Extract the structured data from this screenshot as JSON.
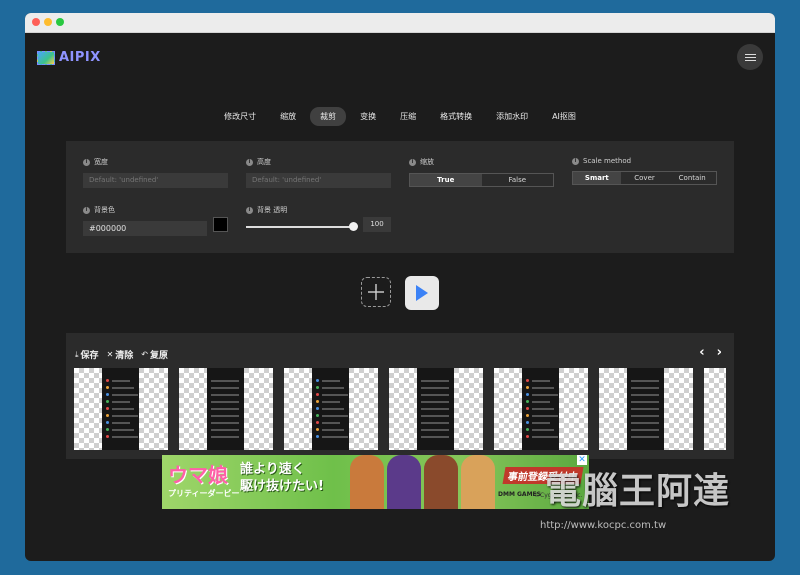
{
  "app": {
    "name": "AIPIX"
  },
  "tabs": [
    {
      "label": "修改尺寸",
      "active": false
    },
    {
      "label": "缩放",
      "active": false
    },
    {
      "label": "裁剪",
      "active": true
    },
    {
      "label": "变换",
      "active": false
    },
    {
      "label": "压缩",
      "active": false
    },
    {
      "label": "格式转换",
      "active": false
    },
    {
      "label": "添加水印",
      "active": false
    },
    {
      "label": "AI抠图",
      "active": false
    }
  ],
  "settings": {
    "width": {
      "label": "宽度",
      "placeholder": "Default: 'undefined'"
    },
    "height": {
      "label": "高度",
      "placeholder": "Default: 'undefined'"
    },
    "scale": {
      "label": "缩放",
      "options": [
        "True",
        "False"
      ],
      "selected": "True"
    },
    "scale_method": {
      "label": "Scale method",
      "options": [
        "Smart",
        "Cover",
        "Contain"
      ],
      "selected": "Smart"
    },
    "bg_color": {
      "label": "背景色",
      "value": "#000000",
      "swatch": "#000000"
    },
    "bg_opacity": {
      "label": "背景 透明",
      "value": "100",
      "fraction": 1.0
    }
  },
  "results": {
    "save_label": "保存",
    "clear_label": "清除",
    "restore_label": "复原",
    "thumbnail_count": 7
  },
  "ad": {
    "logo": "ウマ娘",
    "logo_sub": "プリティーダービー",
    "slogan_line1": "誰より速く",
    "slogan_line2": "駆け抜けたい!",
    "cta": "事前登録受付中",
    "brand": "DMM GAMES",
    "copyright": "©Cygames, Inc.",
    "close": "✕"
  },
  "watermark": {
    "text": "電腦王阿達",
    "url": "http://www.kocpc.com.tw"
  },
  "colors": {
    "accent": "#8f94ff",
    "play": "#3b82f6",
    "bg": "#1c1c1c",
    "panel": "#2b2b2b"
  }
}
